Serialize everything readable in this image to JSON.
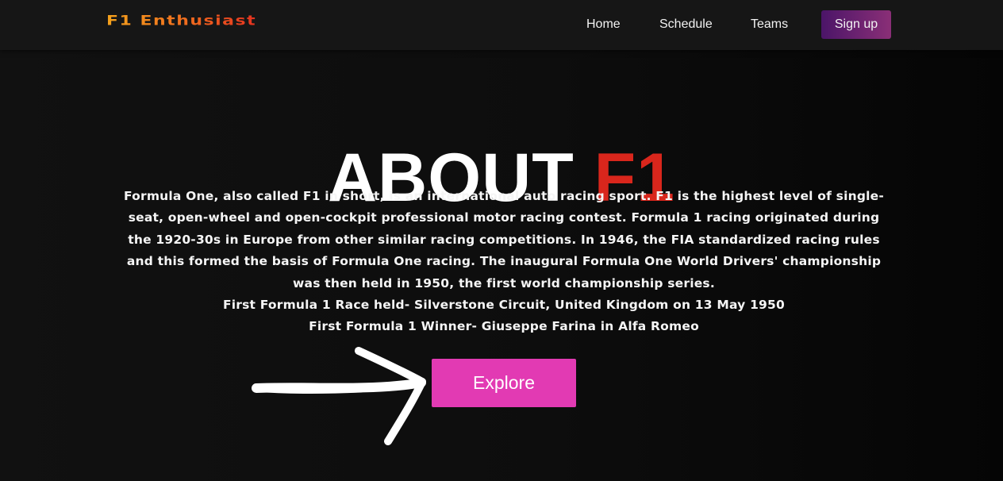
{
  "header": {
    "logo": "F1 Enthusiast",
    "nav": [
      {
        "label": "Home"
      },
      {
        "label": "Schedule"
      },
      {
        "label": "Teams"
      }
    ],
    "signup_label": "Sign up"
  },
  "hero": {
    "title_main": "ABOUT",
    "title_accent": "F1",
    "paragraph": "Formula One, also called F1 in short, is an international auto racing sport. F1 is the highest level of single-seat, open-wheel and open-cockpit professional motor racing contest. Formula 1 racing originated during the 1920-30s in Europe from other similar racing competitions. In 1946, the FIA standardized racing rules and this formed the basis of Formula One racing. The inaugural Formula One World Drivers' championship was then held in 1950, the first world championship series.",
    "first_race": "First Formula 1 Race held- Silverstone Circuit, United Kingdom on 13 May 1950",
    "first_winner": "First Formula 1 Winner- Giuseppe Farina in Alfa Romeo",
    "explore_label": "Explore"
  },
  "colors": {
    "accent_red": "#d9261c",
    "explore_pink": "#e23ab3",
    "signup_gradient_start": "#4b1568",
    "signup_gradient_end": "#8a2f77"
  },
  "icons": {
    "annotation": "hand-drawn-arrow-icon"
  }
}
